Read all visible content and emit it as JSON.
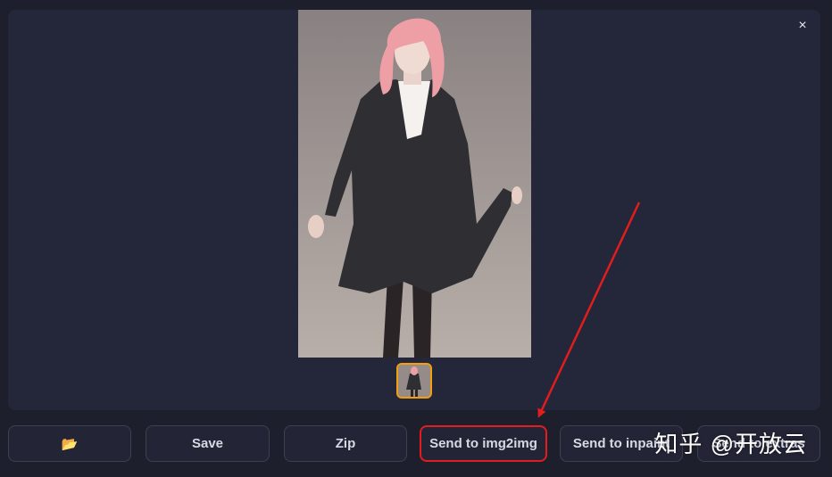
{
  "gallery": {
    "close_label": "×",
    "main_image": {
      "subject": "pink-haired woman in dark blazer coat and white shirt"
    },
    "thumbnails": [
      {
        "selected": true
      }
    ]
  },
  "toolbar": {
    "buttons": [
      {
        "id": "open-folder",
        "label": "📂",
        "icon": "folder-icon"
      },
      {
        "id": "save",
        "label": "Save"
      },
      {
        "id": "zip",
        "label": "Zip"
      },
      {
        "id": "send-img2img",
        "label": "Send to img2img",
        "highlighted": true
      },
      {
        "id": "send-inpaint",
        "label": "Send to inpaint"
      },
      {
        "id": "send-extras",
        "label": "Send to extras"
      }
    ]
  },
  "annotation": {
    "highlight_color": "#e11d1d",
    "arrow_color": "#e11d1d"
  },
  "watermark": {
    "text": "知乎 @开放云"
  },
  "colors": {
    "background": "#1e1f2c",
    "panel": "#24263a",
    "button": "#232536",
    "thumb_border": "#f59e0b"
  }
}
